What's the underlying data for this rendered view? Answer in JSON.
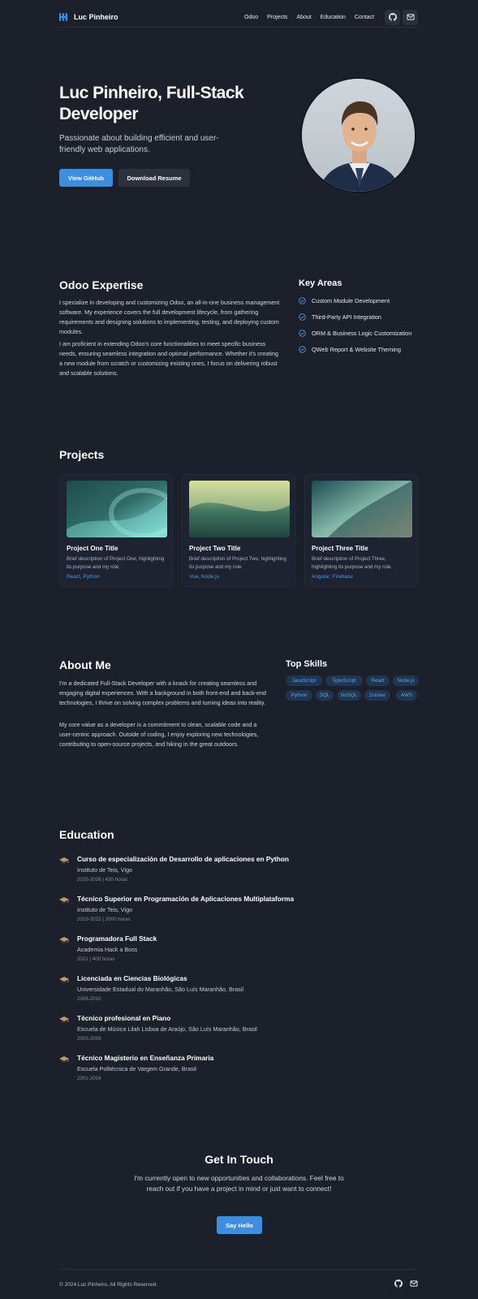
{
  "nav": {
    "brand": "Luc Pinheiro",
    "links": [
      "Odoo",
      "Projects",
      "About",
      "Education",
      "Contact"
    ],
    "icons": [
      "github-icon",
      "mail-icon"
    ]
  },
  "hero": {
    "title": "Luc Pinheiro, Full-Stack Developer",
    "subtitle": "Passionate about building efficient and user-friendly web applications.",
    "primary_button": "View GitHub",
    "secondary_button": "Download Resume"
  },
  "odoo": {
    "heading": "Odoo Expertise",
    "paragraphs": [
      "I specialize in developing and customizing Odoo, an all-in-one business management software. My experience covers the full development lifecycle, from gathering requirements and designing solutions to implementing, testing, and deploying custom modules.",
      "I am proficient in extending Odoo's core functionalities to meet specific business needs, ensuring seamless integration and optimal performance. Whether it's creating a new module from scratch or customizing existing ones, I focus on delivering robust and scalable solutions."
    ],
    "key_areas_heading": "Key Areas",
    "key_areas": [
      "Custom Module Development",
      "Third-Party API Integration",
      "ORM & Business Logic Customization",
      "QWeb Report & Website Theming"
    ]
  },
  "projects": {
    "heading": "Projects",
    "items": [
      {
        "title": "Project One Title",
        "description": "Brief description of Project One, highlighting its purpose and my role.",
        "tags": "React, Python"
      },
      {
        "title": "Project Two Title",
        "description": "Brief description of Project Two, highlighting its purpose and my role.",
        "tags": "Vue, Node.js"
      },
      {
        "title": "Project Three Title",
        "description": "Brief description of Project Three, highlighting its purpose and my role.",
        "tags": "Angular, Firebase"
      }
    ]
  },
  "about": {
    "heading": "About Me",
    "paragraphs": [
      "I'm a dedicated Full-Stack Developer with a knack for creating seamless and engaging digital experiences. With a background in both front-end and back-end technologies, I thrive on solving complex problems and turning ideas into reality.",
      "My core value as a developer is a commitment to clean, scalable code and a user-centric approach. Outside of coding, I enjoy exploring new technologies, contributing to open-source projects, and hiking in the great outdoors."
    ],
    "skills_heading": "Top Skills",
    "skills": [
      "JavaScript",
      "TypeScript",
      "React",
      "Node.js",
      "Python",
      "SQL",
      "NoSQL",
      "Docker",
      "AWS"
    ]
  },
  "education": {
    "heading": "Education",
    "items": [
      {
        "title": "Curso de especialización de Desarrollo de aplicaciones en Python",
        "institution": "Instituto de Teis, Vigo",
        "date": "2025-2026 | 430 horas"
      },
      {
        "title": "Técnico Superior en Programación de Aplicaciones Multiplataforma",
        "institution": "Instituto de Teis, Vigo",
        "date": "2019-2022 | 2000 horas"
      },
      {
        "title": "Programadora Full Stack",
        "institution": "Academia Hack a Boss",
        "date": "2021 | 400 horas"
      },
      {
        "title": "Licenciada en Ciencias Biológicas",
        "institution": "Universidade Estadual do Maranhão, São Luís Maranhão, Brasil",
        "date": "2006-2010"
      },
      {
        "title": "Técnico profesional en Piano",
        "institution": "Escuela de Música Lilah Lisboa de Araújo, São Luís Maranhão, Brasil",
        "date": "2005-2009"
      },
      {
        "title": "Técnico Magisterio en Enseñanza Primaria",
        "institution": "Escuela Politécnica de Vargem Grande, Brasil",
        "date": "2001-2004"
      }
    ]
  },
  "contact": {
    "heading": "Get In Touch",
    "text": "I'm currently open to new opportunities and collaborations. Feel free to reach out if you have a project in mind or just want to connect!",
    "button": "Say Hello"
  },
  "footer": {
    "copyright": "© 2024 Luc Pinheiro. All Rights Reserved."
  },
  "colors": {
    "background": "#1b202b",
    "accent": "#3b8ee0",
    "chip_bg": "#1f3550"
  }
}
